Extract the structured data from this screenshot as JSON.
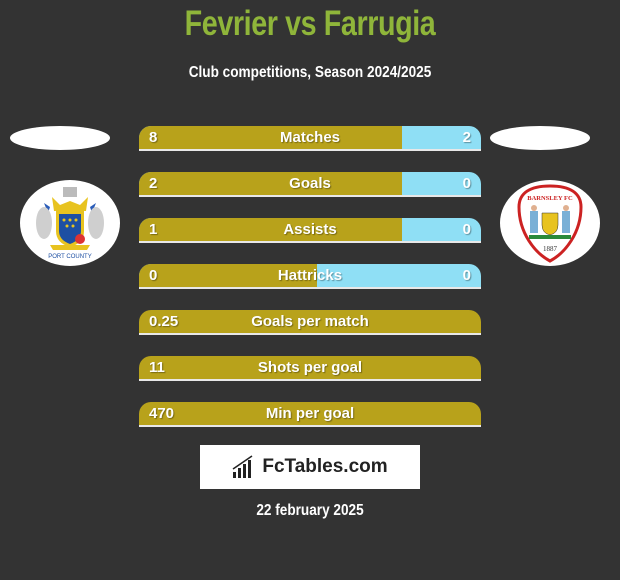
{
  "header": {
    "title": "Fevrier vs Farrugia",
    "subtitle": "Club competitions, Season 2024/2025"
  },
  "teams": {
    "left": {
      "name": "Stockport County",
      "logo_text": "PORT COUNTY"
    },
    "right": {
      "name": "Barnsley FC",
      "logo_text": "BARNSLEY FC",
      "year": "1887"
    }
  },
  "colors": {
    "title": "#8fb53a",
    "left_bar": "#b8a21b",
    "right_bar": "#8fdff5",
    "background": "#333333"
  },
  "stats": [
    {
      "label": "Matches",
      "left": "8",
      "right": "2",
      "left_share": 0.77
    },
    {
      "label": "Goals",
      "left": "2",
      "right": "0",
      "left_share": 0.77
    },
    {
      "label": "Assists",
      "left": "1",
      "right": "0",
      "left_share": 0.77
    },
    {
      "label": "Hattricks",
      "left": "0",
      "right": "0",
      "left_share": 0.52
    },
    {
      "label": "Goals per match",
      "left": "0.25",
      "right": null,
      "left_share": 1
    },
    {
      "label": "Shots per goal",
      "left": "11",
      "right": null,
      "left_share": 1
    },
    {
      "label": "Min per goal",
      "left": "470",
      "right": null,
      "left_share": 1
    }
  ],
  "brand": {
    "text": "FcTables.com"
  },
  "footer": {
    "date": "22 february 2025"
  }
}
